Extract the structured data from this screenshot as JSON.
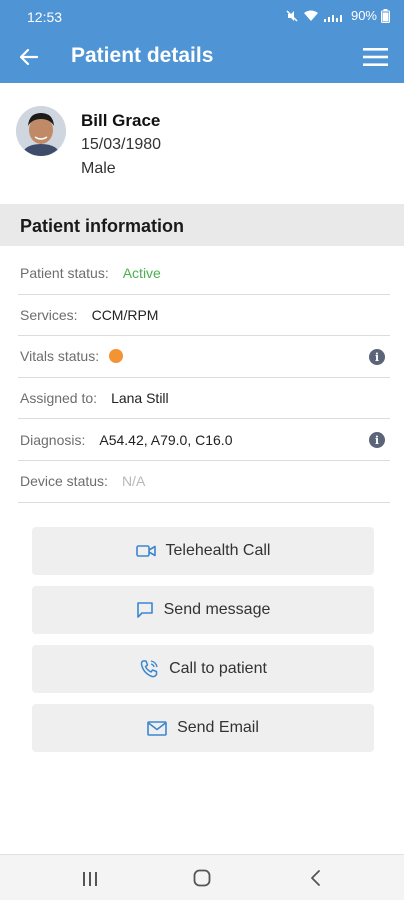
{
  "status_bar": {
    "time": "12:53",
    "battery": "90%"
  },
  "header": {
    "title": "Patient details"
  },
  "patient": {
    "name": "Bill Grace",
    "dob": "15/03/1980",
    "gender": "Male"
  },
  "section": {
    "title": "Patient information"
  },
  "info": {
    "status_label": "Patient status:",
    "status_value": "Active",
    "services_label": "Services:",
    "services_value": "CCM/RPM",
    "vitals_label": "Vitals status:",
    "assigned_label": "Assigned to:",
    "assigned_value": "Lana Still",
    "diagnosis_label": "Diagnosis:",
    "diagnosis_value": "A54.42, A79.0, C16.0",
    "device_label": "Device status:",
    "device_value": "N/A"
  },
  "actions": {
    "telehealth": "Telehealth Call",
    "message": "Send message",
    "call": "Call to patient",
    "email": "Send Email"
  },
  "colors": {
    "appbar": "#4f94d4",
    "active": "#4caf50",
    "vitals_dot": "#f39433",
    "icon_blue": "#3b86cf"
  },
  "icons": [
    "back-arrow-icon",
    "hamburger-menu-icon",
    "info-icon",
    "video-camera-icon",
    "chat-bubble-icon",
    "phone-icon",
    "mail-icon"
  ]
}
